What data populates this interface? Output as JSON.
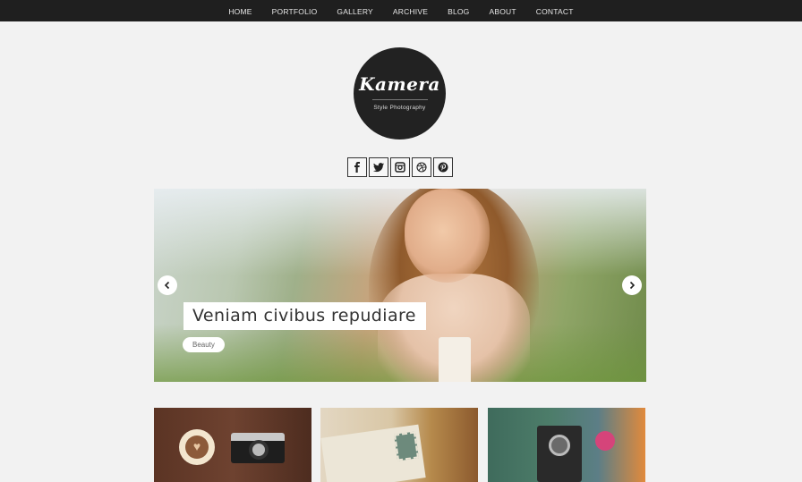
{
  "nav": {
    "items": [
      {
        "label": "HOME"
      },
      {
        "label": "PORTFOLIO"
      },
      {
        "label": "GALLERY"
      },
      {
        "label": "ARCHIVE"
      },
      {
        "label": "BLOG"
      },
      {
        "label": "ABOUT"
      },
      {
        "label": "CONTACT"
      }
    ]
  },
  "logo": {
    "name": "Kamera",
    "tagline": "Style Photography"
  },
  "social": {
    "icons": [
      "facebook-icon",
      "twitter-icon",
      "instagram-icon",
      "dribbble-icon",
      "pinterest-icon"
    ]
  },
  "slider": {
    "title": "Veniam civibus repudiare",
    "category": "Beauty"
  },
  "cards": [
    {
      "image": "coffee-and-camera"
    },
    {
      "image": "vintage-postcards"
    },
    {
      "image": "rolleiflex-camera"
    }
  ],
  "colors": {
    "nav_bg": "#1f1f1f",
    "page_bg": "#f2f2f2",
    "logo_bg": "#222222"
  }
}
